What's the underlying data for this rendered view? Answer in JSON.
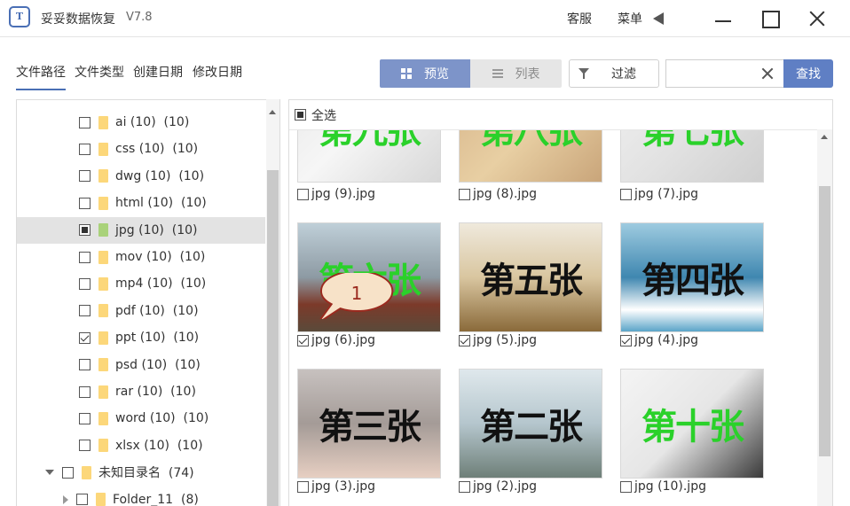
{
  "app": {
    "title": "妥妥数据恢复",
    "version": "V7.8",
    "logo": "T"
  },
  "titlebar": {
    "service": "客服",
    "menu": "菜单"
  },
  "category_tabs": [
    "文件路径",
    "文件类型",
    "创建日期",
    "修改日期"
  ],
  "view_toggle": {
    "preview": "预览",
    "list": "列表"
  },
  "filter_label": "过滤",
  "search": {
    "value": "",
    "button": "查找"
  },
  "tree": [
    {
      "label": "ai (10)  (10)",
      "state": "unchecked",
      "type": "folder"
    },
    {
      "label": "css (10)  (10)",
      "state": "unchecked",
      "type": "folder"
    },
    {
      "label": "dwg (10)  (10)",
      "state": "unchecked",
      "type": "folder"
    },
    {
      "label": "html (10)  (10)",
      "state": "unchecked",
      "type": "folder"
    },
    {
      "label": "jpg (10)  (10)",
      "state": "partial",
      "type": "folder",
      "selected": true
    },
    {
      "label": "mov (10)  (10)",
      "state": "unchecked",
      "type": "folder"
    },
    {
      "label": "mp4 (10)  (10)",
      "state": "unchecked",
      "type": "folder"
    },
    {
      "label": "pdf (10)  (10)",
      "state": "unchecked",
      "type": "folder"
    },
    {
      "label": "ppt (10)  (10)",
      "state": "checked",
      "type": "folder"
    },
    {
      "label": "psd (10)  (10)",
      "state": "unchecked",
      "type": "folder"
    },
    {
      "label": "rar (10)  (10)",
      "state": "unchecked",
      "type": "folder"
    },
    {
      "label": "word (10)  (10)",
      "state": "unchecked",
      "type": "folder"
    },
    {
      "label": "xlsx (10)  (10)",
      "state": "unchecked",
      "type": "folder"
    },
    {
      "label": "未知目录名  (74)",
      "state": "unchecked",
      "type": "root"
    },
    {
      "label": "Folder_11  (8)",
      "state": "unchecked",
      "type": "subfolder"
    }
  ],
  "select_all": "全选",
  "thumbnails": [
    {
      "file": "jpg (9).jpg",
      "checked": false,
      "text": "第九张",
      "text_color": "green"
    },
    {
      "file": "jpg (8).jpg",
      "checked": false,
      "text": "第八张",
      "text_color": "green"
    },
    {
      "file": "jpg (7).jpg",
      "checked": false,
      "text": "第七张",
      "text_color": "green"
    },
    {
      "file": "jpg (6).jpg",
      "checked": true,
      "text": "第六张",
      "text_color": "green"
    },
    {
      "file": "jpg (5).jpg",
      "checked": true,
      "text": "第五张",
      "text_color": "black"
    },
    {
      "file": "jpg (4).jpg",
      "checked": true,
      "text": "第四张",
      "text_color": "black"
    },
    {
      "file": "jpg (3).jpg",
      "checked": false,
      "text": "第三张",
      "text_color": "black"
    },
    {
      "file": "jpg (2).jpg",
      "checked": false,
      "text": "第二张",
      "text_color": "black"
    },
    {
      "file": "jpg (10).jpg",
      "checked": false,
      "text": "第十张",
      "text_color": "green"
    }
  ],
  "callout_number": "1",
  "colors": {
    "accent": "#5f7fc4",
    "preview_active": "#7d94c9",
    "folder": "#fcd77a",
    "green_text": "#2ad12a"
  }
}
